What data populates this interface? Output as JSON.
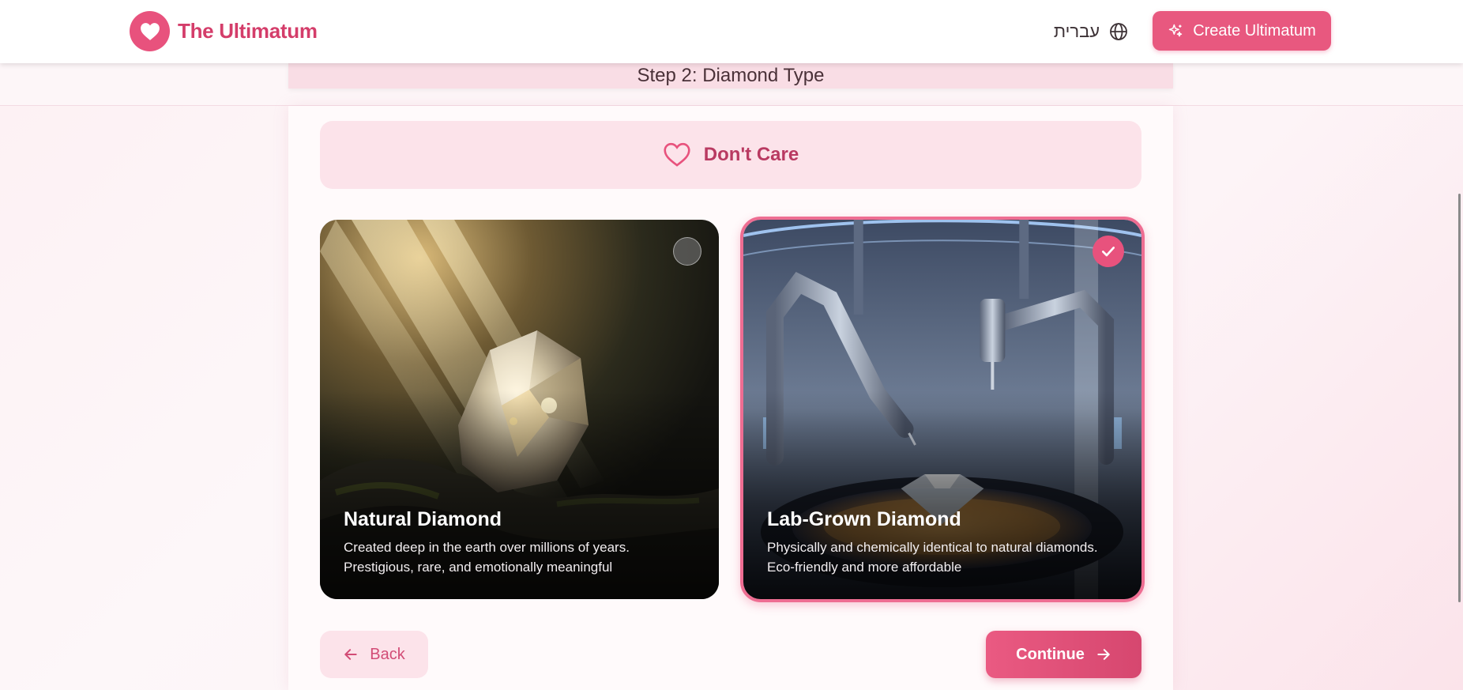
{
  "header": {
    "brand_name": "The Ultimatum",
    "language_label": "עברית",
    "create_button_label": "Create Ultimatum"
  },
  "step": {
    "title": "Step 2: Diamond Type"
  },
  "options": {
    "dont_care_label": "Don't Care",
    "cards": [
      {
        "title": "Natural Diamond",
        "description_line1": "Created deep in the earth over millions of years.",
        "description_line2": "Prestigious, rare, and emotionally meaningful",
        "selected": false
      },
      {
        "title": "Lab-Grown Diamond",
        "description_line1": "Physically and chemically identical to natural diamonds.",
        "description_line2": "Eco-friendly and more affordable",
        "selected": true
      }
    ]
  },
  "nav": {
    "back_label": "Back",
    "continue_label": "Continue"
  },
  "colors": {
    "accent": "#e8527d",
    "accent_dark": "#d43d6a",
    "soft_pink": "#fce3ea"
  },
  "icons": {
    "logo": "heart-icon",
    "language": "globe-icon",
    "create": "sparkles-icon",
    "dont_care": "heart-outline-icon",
    "selected": "check-icon",
    "back": "arrow-left-icon",
    "continue": "arrow-right-icon"
  }
}
